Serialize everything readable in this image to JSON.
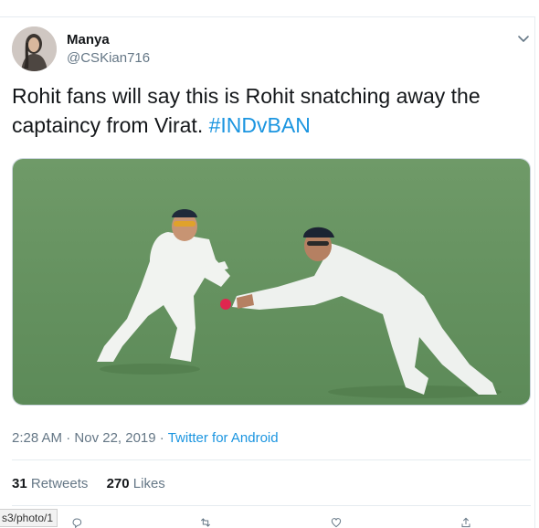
{
  "tweet": {
    "author_name": "Manya",
    "author_handle": "@CSKian716",
    "text": "Rohit fans will say this is Rohit snatching away the captaincy from Virat. ",
    "hashtag": "#INDvBAN",
    "time": "2:28 AM",
    "separator": "·",
    "date": "Nov 22, 2019",
    "source": "Twitter for Android",
    "retweets_count": "31",
    "retweets_label": "Retweets",
    "likes_count": "270",
    "likes_label": "Likes"
  },
  "status_bar": {
    "url_fragment": "s3/photo/1"
  },
  "icons": {
    "menu": "chevron-down-icon",
    "reply": "reply-icon",
    "retweet": "retweet-icon",
    "like": "heart-icon",
    "share": "share-icon"
  },
  "colors": {
    "accent": "#1b95e0",
    "secondary_text": "#657786",
    "primary_text": "#14171a",
    "field_green": "#5f8d5a"
  }
}
